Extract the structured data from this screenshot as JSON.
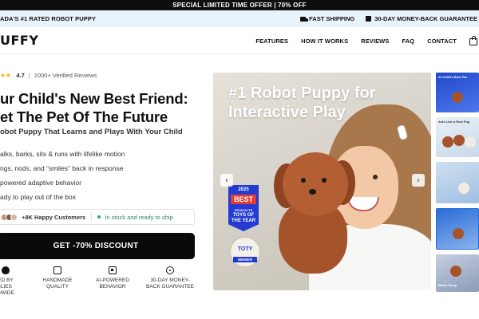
{
  "promo": {
    "text": "SPECIAL LIMITED TIME OFFER | 70% OFF"
  },
  "trust": {
    "left": "ADA'S #1 RATED ROBOT PUPPY",
    "shipping": "FAST SHIPPING",
    "guarantee": "30-DAY MONEY-BACK GUARANTEE"
  },
  "nav": {
    "logo": "UFFY",
    "links": [
      "FEATURES",
      "HOW IT WORKS",
      "REVIEWS",
      "FAQ",
      "CONTACT"
    ],
    "cart_icon": "shopping-bag-icon"
  },
  "hero": {
    "rating": "4.7",
    "reviews": "1000+ Verified Reviews",
    "headline_line1": "ur Child's New Best Friend:",
    "headline_line2": "et The Pet Of The Future",
    "subhead": "obot Puppy That Learns and Plays With Your Child",
    "features": [
      "alks, barks, sits & runs with lifelike motion",
      "ngs, nods, and “smiles” back in response",
      "powered adaptive behavior",
      "ady to play out of the box"
    ],
    "happy_customers": "+8K Happy Customers",
    "stock": "In stock and ready to ship",
    "cta": "GET -70% DISCOUNT"
  },
  "badges": [
    {
      "icon": "paw-icon",
      "line1": "ED BY",
      "line2": "ILIES",
      "line3": "DWIDE"
    },
    {
      "icon": "hand-icon",
      "line1": "HANDMADE",
      "line2": "QUALITY",
      "line3": ""
    },
    {
      "icon": "chip-icon",
      "line1": "AI-POWERED",
      "line2": "BEHAVIOR",
      "line3": ""
    },
    {
      "icon": "guarantee-icon",
      "line1": "30-DAY MONEY-",
      "line2": "BACK GUARANTEE",
      "line3": ""
    }
  ],
  "product_image": {
    "title": "#1 Robot Puppy for Interactive Play",
    "award_year": "2025",
    "award_best": "BEST",
    "award_products": "PRODUCTS",
    "award_toys": "TOYS OF THE YEAR",
    "toty": "TOTY",
    "toty_winner": "WINNER"
  },
  "thumbnails": [
    {
      "caption": "#1 Child's Best Pal"
    },
    {
      "caption": "Acts Like a Real Pup"
    },
    {
      "caption": ""
    },
    {
      "caption": ""
    },
    {
      "caption": "Better Sleep"
    }
  ]
}
